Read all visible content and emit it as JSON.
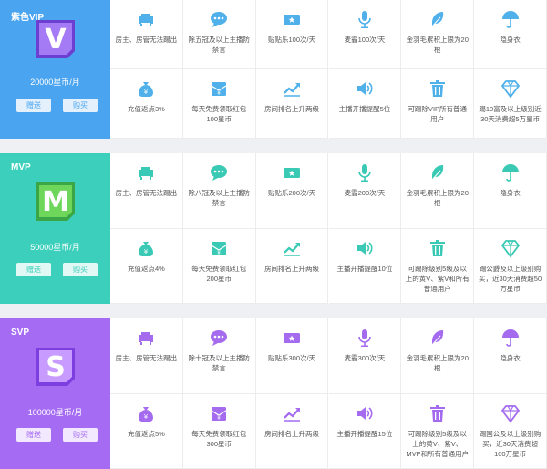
{
  "colors": {
    "purple_vip": "#4d9ee8",
    "mvp": "#3fd3be",
    "svp": "#a56cf3"
  },
  "tiers": [
    {
      "name": "紫色VIP",
      "price": "20000星币/月",
      "gift": "赠送",
      "buy": "购买",
      "badge_letter": "V",
      "accent": "#4ba4ef",
      "icon_color": "#4fb0ea",
      "row1": [
        "房主、房管无法踢出",
        "除五冠及以上主播防禁言",
        "贴贴乐100次/天",
        "麦霸100次/天",
        "金羽毛累积上限为20根",
        "隐身衣"
      ],
      "row2": [
        "充值返点3%",
        "每天免费领取红包100星币",
        "房间排名上升两级",
        "主播开播提醒5位",
        "可踢除VIP所有普通用户",
        "踢10富及以上级别近30天消费超5万星币"
      ]
    },
    {
      "name": "MVP",
      "price": "50000星币/月",
      "gift": "赠送",
      "buy": "购买",
      "badge_letter": "M",
      "accent": "#3ccfbb",
      "icon_color": "#39c9b4",
      "row1": [
        "房主、房管无法踢出",
        "除八冠及以上主播防禁言",
        "贴贴乐200次/天",
        "麦霸200次/天",
        "金羽毛累积上限为20根",
        "隐身衣"
      ],
      "row2": [
        "充值返点4%",
        "每天免费领取红包200星币",
        "房间排名上升两级",
        "主播开播提醒10位",
        "可踢除级别5级及以上的黄V、紫V和所有普通用户",
        "踢公爵及以上级别购买，近30天消费超50万星币"
      ]
    },
    {
      "name": "SVP",
      "price": "100000星币/月",
      "gift": "赠送",
      "buy": "购买",
      "badge_letter": "S",
      "accent": "#a56cf3",
      "icon_color": "#a46bee",
      "row1": [
        "房主、房管无法踢出",
        "除十冠及以上主播防禁言",
        "贴贴乐300次/天",
        "麦霸300次/天",
        "金羽毛累积上限为20根",
        "隐身衣"
      ],
      "row2": [
        "充值返点5%",
        "每天免费领取红包300星币",
        "房间排名上升两级",
        "主播开播提醒15位",
        "可踢除级别5级及以上的黄V、紫V、MVP和所有普通用户",
        "踢国公及以上级别购买，近30天消费超100万星币"
      ]
    }
  ],
  "icons_row1": [
    "sofa-icon",
    "chat-bubble-icon",
    "ticket-icon",
    "microphone-icon",
    "feather-icon",
    "umbrella-icon"
  ],
  "icons_row2": [
    "money-bag-icon",
    "red-packet-icon",
    "trend-chart-icon",
    "speaker-icon",
    "trash-icon",
    "diamond-icon"
  ]
}
